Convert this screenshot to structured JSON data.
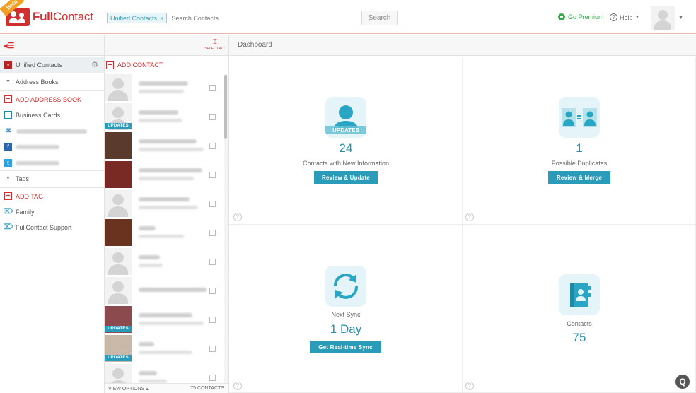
{
  "header": {
    "brand_bold": "Full",
    "brand_rest": "Contact",
    "beta_badge": "Beta",
    "search_chip": "Unified Contacts",
    "search_chip_close": "×",
    "search_placeholder": "Search Contacts",
    "search_button": "Search",
    "premium": "Go Premium",
    "help": "Help"
  },
  "subbar": {
    "select_all": "SELECT ALL",
    "dashboard_title": "Dashboard"
  },
  "sidebar": {
    "unified_contacts": "Unified Contacts",
    "address_books_header": "Address Books",
    "add_address_book": "ADD ADDRESS BOOK",
    "business_cards": "Business Cards",
    "tags_header": "Tags",
    "add_tag": "ADD TAG",
    "tag_family": "Family",
    "tag_support": "FullContact Support"
  },
  "contacts": {
    "add_contact": "ADD CONTACT",
    "update_badge": "UPDATES",
    "view_options": "VIEW OPTIONS ▴",
    "count_label": "75 CONTACTS"
  },
  "dashboard": {
    "updates": {
      "tile_label": "UPDATES",
      "count": "24",
      "label": "Contacts with New Information",
      "button": "Review & Update"
    },
    "duplicates": {
      "count": "1",
      "label": "Possible Duplicates",
      "button": "Review & Merge"
    },
    "sync": {
      "label": "Next Sync",
      "value": "1 Day",
      "button": "Get Real-time Sync"
    },
    "total": {
      "label": "Contacts",
      "count": "75"
    }
  },
  "colors": {
    "brand_red": "#d12f2f",
    "accent_teal": "#2a9bb9",
    "premium_green": "#3aa84c"
  }
}
